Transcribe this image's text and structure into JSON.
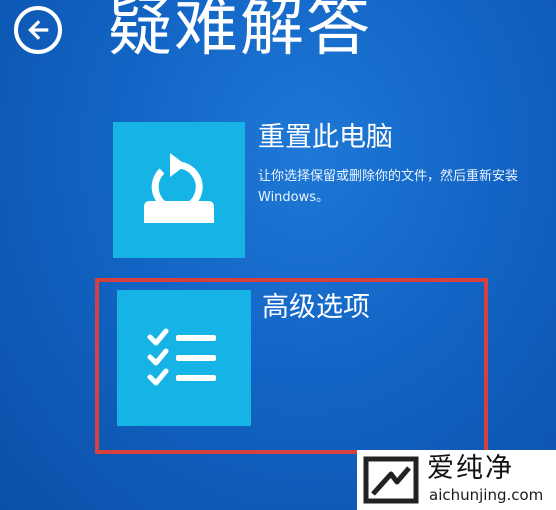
{
  "header": {
    "back_icon": "back-arrow-icon",
    "title": "疑难解答"
  },
  "options": [
    {
      "icon": "reset-pc-icon",
      "title": "重置此电脑",
      "description": "让你选择保留或删除你的文件，然后重新安装 Windows。"
    },
    {
      "icon": "checklist-icon",
      "title": "高级选项",
      "highlighted": true
    }
  ],
  "watermark": {
    "name": "爱纯净",
    "url": "aichunjing.com"
  },
  "colors": {
    "background": "#1264c4",
    "tile": "#16b4e6",
    "highlight_border": "#d6403f",
    "text": "#ffffff"
  }
}
